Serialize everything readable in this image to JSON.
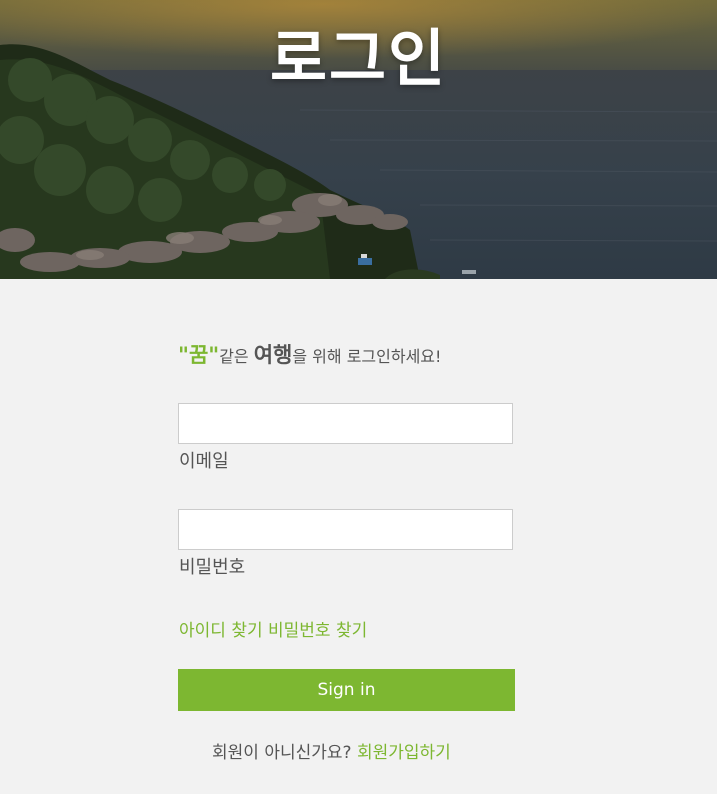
{
  "hero": {
    "title": "로그인",
    "image_icon": "coastal-island-photo"
  },
  "tagline": {
    "quote_word": "\"꿈\"",
    "part1": "같은 ",
    "bold_word": "여행",
    "part2": "을 위해 로그인하세요!"
  },
  "form": {
    "email_value": "",
    "email_label": "이메일",
    "password_value": "",
    "password_label": "비밀번호"
  },
  "links": {
    "find_id": "아이디 찾기",
    "find_password": "비밀번호 찾기"
  },
  "signin_label": "Sign in",
  "signup": {
    "prompt": "회원이 아니신가요? ",
    "link": "회원가입하기"
  },
  "colors": {
    "accent": "#7db731",
    "text": "#555555",
    "background": "#f2f2f2"
  }
}
